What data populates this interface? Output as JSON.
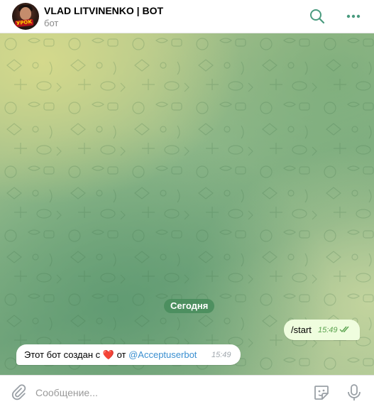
{
  "header": {
    "title": "VLAD LITVINENKO | BOT",
    "subtitle": "бот",
    "avatar_badge": "УРОК",
    "search_icon": "search-icon",
    "menu_icon": "more-dots-icon"
  },
  "chat": {
    "date_separator": "Сегодня",
    "messages": [
      {
        "direction": "outgoing",
        "text": "/start",
        "time": "15:49",
        "status": "read"
      },
      {
        "direction": "incoming",
        "text_before": "Этот бот создан с",
        "emoji": "❤️",
        "text_after": "от",
        "link": "@Acceptuserbot",
        "time": "15:49"
      }
    ]
  },
  "composer": {
    "placeholder": "Сообщение...",
    "attach_icon": "paperclip-icon",
    "emoji_icon": "sticker-icon",
    "mic_icon": "microphone-icon"
  },
  "colors": {
    "accent": "#4a9b7f",
    "outgoing_bubble": "#effdde",
    "link": "#3a8fd0",
    "date_pill": "#488c5c"
  }
}
